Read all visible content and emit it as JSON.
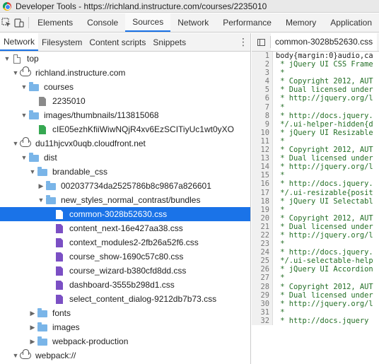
{
  "window": {
    "title": "Developer Tools - https://richland.instructure.com/courses/2235010"
  },
  "main_tabs": [
    "Elements",
    "Console",
    "Sources",
    "Network",
    "Performance",
    "Memory",
    "Application"
  ],
  "active_main_tab": "Sources",
  "icons": {
    "inspect": "inspect-element-icon",
    "device": "device-toolbar-icon",
    "more": "kebab-menu-icon",
    "navigator": "toggle-navigator-icon"
  },
  "colors": {
    "accent": "#1a73e8",
    "folder": "#7ab5e8",
    "css_file": "#7b4fc4",
    "image_file": "#36a852"
  },
  "sources": {
    "subtabs": [
      "Network",
      "Filesystem",
      "Content scripts",
      "Snippets"
    ],
    "active_subtab": "Network",
    "tree": [
      {
        "label": "top",
        "depth": 0,
        "icon": "page",
        "arrow": "down"
      },
      {
        "label": "richland.instructure.com",
        "depth": 1,
        "icon": "cloud",
        "arrow": "down"
      },
      {
        "label": "courses",
        "depth": 2,
        "icon": "folder",
        "arrow": "down"
      },
      {
        "label": "2235010",
        "depth": 3,
        "icon": "file-gray",
        "arrow": ""
      },
      {
        "label": "images/thumbnails/113815068",
        "depth": 2,
        "icon": "folder",
        "arrow": "down"
      },
      {
        "label": "cIE05ezhKfiiWiwNQjR4xv6EzSCITiyUc1wt0yXO",
        "depth": 3,
        "icon": "file-green",
        "arrow": ""
      },
      {
        "label": "du11hjcvx0uqb.cloudfront.net",
        "depth": 1,
        "icon": "cloud",
        "arrow": "down"
      },
      {
        "label": "dist",
        "depth": 2,
        "icon": "folder",
        "arrow": "down"
      },
      {
        "label": "brandable_css",
        "depth": 3,
        "icon": "folder",
        "arrow": "down"
      },
      {
        "label": "002037734da2525786b8c9867a826601",
        "depth": 4,
        "icon": "folder",
        "arrow": "right"
      },
      {
        "label": "new_styles_normal_contrast/bundles",
        "depth": 4,
        "icon": "folder",
        "arrow": "down"
      },
      {
        "label": "common-3028b52630.css",
        "depth": 5,
        "icon": "file-purple",
        "arrow": "",
        "selected": true
      },
      {
        "label": "content_next-16e427aa38.css",
        "depth": 5,
        "icon": "file-purple",
        "arrow": ""
      },
      {
        "label": "context_modules2-2fb26a52f6.css",
        "depth": 5,
        "icon": "file-purple",
        "arrow": ""
      },
      {
        "label": "course_show-1690c57c80.css",
        "depth": 5,
        "icon": "file-purple",
        "arrow": ""
      },
      {
        "label": "course_wizard-b380cfd8dd.css",
        "depth": 5,
        "icon": "file-purple",
        "arrow": ""
      },
      {
        "label": "dashboard-3555b298d1.css",
        "depth": 5,
        "icon": "file-purple",
        "arrow": ""
      },
      {
        "label": "select_content_dialog-9212db7b73.css",
        "depth": 5,
        "icon": "file-purple",
        "arrow": ""
      },
      {
        "label": "fonts",
        "depth": 3,
        "icon": "folder",
        "arrow": "right"
      },
      {
        "label": "images",
        "depth": 3,
        "icon": "folder",
        "arrow": "right"
      },
      {
        "label": "webpack-production",
        "depth": 3,
        "icon": "folder",
        "arrow": "right"
      },
      {
        "label": "webpack://",
        "depth": 1,
        "icon": "cloud",
        "arrow": "down"
      }
    ]
  },
  "editor": {
    "open_file": "common-3028b52630.css",
    "lines": [
      {
        "n": "1",
        "t": "body{margin:0}audio,ca"
      },
      {
        "n": "2",
        "t": " * jQuery UI CSS Frame"
      },
      {
        "n": "3",
        "t": " *"
      },
      {
        "n": "4",
        "t": " * Copyright 2012, AUT"
      },
      {
        "n": "5",
        "t": " * Dual licensed under"
      },
      {
        "n": "6",
        "t": " * http://jquery.org/l"
      },
      {
        "n": "7",
        "t": " *"
      },
      {
        "n": "8",
        "t": " * http://docs.jquery."
      },
      {
        "n": "9",
        "t": " */.ui-helper-hidden{d"
      },
      {
        "n": "10",
        "t": " * jQuery UI Resizable"
      },
      {
        "n": "11",
        "t": " *"
      },
      {
        "n": "12",
        "t": " * Copyright 2012, AUT"
      },
      {
        "n": "13",
        "t": " * Dual licensed under"
      },
      {
        "n": "14",
        "t": " * http://jquery.org/l"
      },
      {
        "n": "15",
        "t": " *"
      },
      {
        "n": "16",
        "t": " * http://docs.jquery."
      },
      {
        "n": "17",
        "t": " */.ui-resizable{posit"
      },
      {
        "n": "18",
        "t": " * jQuery UI Selectabl"
      },
      {
        "n": "19",
        "t": " *"
      },
      {
        "n": "20",
        "t": " * Copyright 2012, AUT"
      },
      {
        "n": "21",
        "t": " * Dual licensed under"
      },
      {
        "n": "22",
        "t": " * http://jquery.org/l"
      },
      {
        "n": "23",
        "t": " *"
      },
      {
        "n": "24",
        "t": " * http://docs.jquery."
      },
      {
        "n": "25",
        "t": " */.ui-selectable-help"
      },
      {
        "n": "26",
        "t": " * jQuery UI Accordion"
      },
      {
        "n": "27",
        "t": " *"
      },
      {
        "n": "28",
        "t": " * Copyright 2012, AUT"
      },
      {
        "n": "29",
        "t": " * Dual licensed under"
      },
      {
        "n": "30",
        "t": " * http://jquery.org/l"
      },
      {
        "n": "31",
        "t": " *"
      },
      {
        "n": "32",
        "t": " * http://docs.jquery"
      }
    ]
  }
}
